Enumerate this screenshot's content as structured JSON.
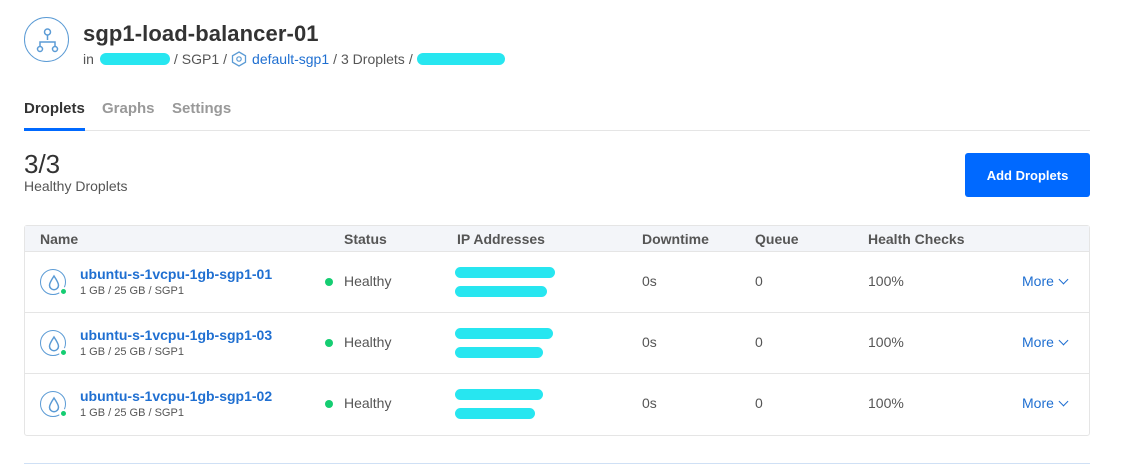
{
  "header": {
    "title": "sgp1-load-balancer-01",
    "breadcrumb": {
      "prefix": "in",
      "region": "SGP1",
      "vpc_link": "default-sgp1",
      "droplet_count": "3 Droplets"
    }
  },
  "tabs": [
    {
      "label": "Droplets",
      "active": true
    },
    {
      "label": "Graphs",
      "active": false
    },
    {
      "label": "Settings",
      "active": false
    }
  ],
  "summary": {
    "count": "3/3",
    "label": "Healthy Droplets",
    "add_button": "Add Droplets"
  },
  "table": {
    "headers": [
      "Name",
      "Status",
      "IP Addresses",
      "Downtime",
      "Queue",
      "Health Checks"
    ],
    "rows": [
      {
        "name": "ubuntu-s-1vcpu-1gb-sgp1-01",
        "meta": "1 GB / 25 GB / SGP1",
        "status": "Healthy",
        "downtime": "0s",
        "queue": "0",
        "health": "100%",
        "action": "More"
      },
      {
        "name": "ubuntu-s-1vcpu-1gb-sgp1-03",
        "meta": "1 GB / 25 GB / SGP1",
        "status": "Healthy",
        "downtime": "0s",
        "queue": "0",
        "health": "100%",
        "action": "More"
      },
      {
        "name": "ubuntu-s-1vcpu-1gb-sgp1-02",
        "meta": "1 GB / 25 GB / SGP1",
        "status": "Healthy",
        "downtime": "0s",
        "queue": "0",
        "health": "100%",
        "action": "More"
      }
    ]
  },
  "colors": {
    "accent": "#0069ff",
    "link": "#1f6fd1",
    "healthy": "#15cd72",
    "redaction": "#27e6f0"
  },
  "icons": {
    "load_balancer": "load-balancer-icon",
    "vpc": "vpc-icon",
    "droplet": "droplet-icon",
    "chevron": "chevron-down-icon"
  }
}
